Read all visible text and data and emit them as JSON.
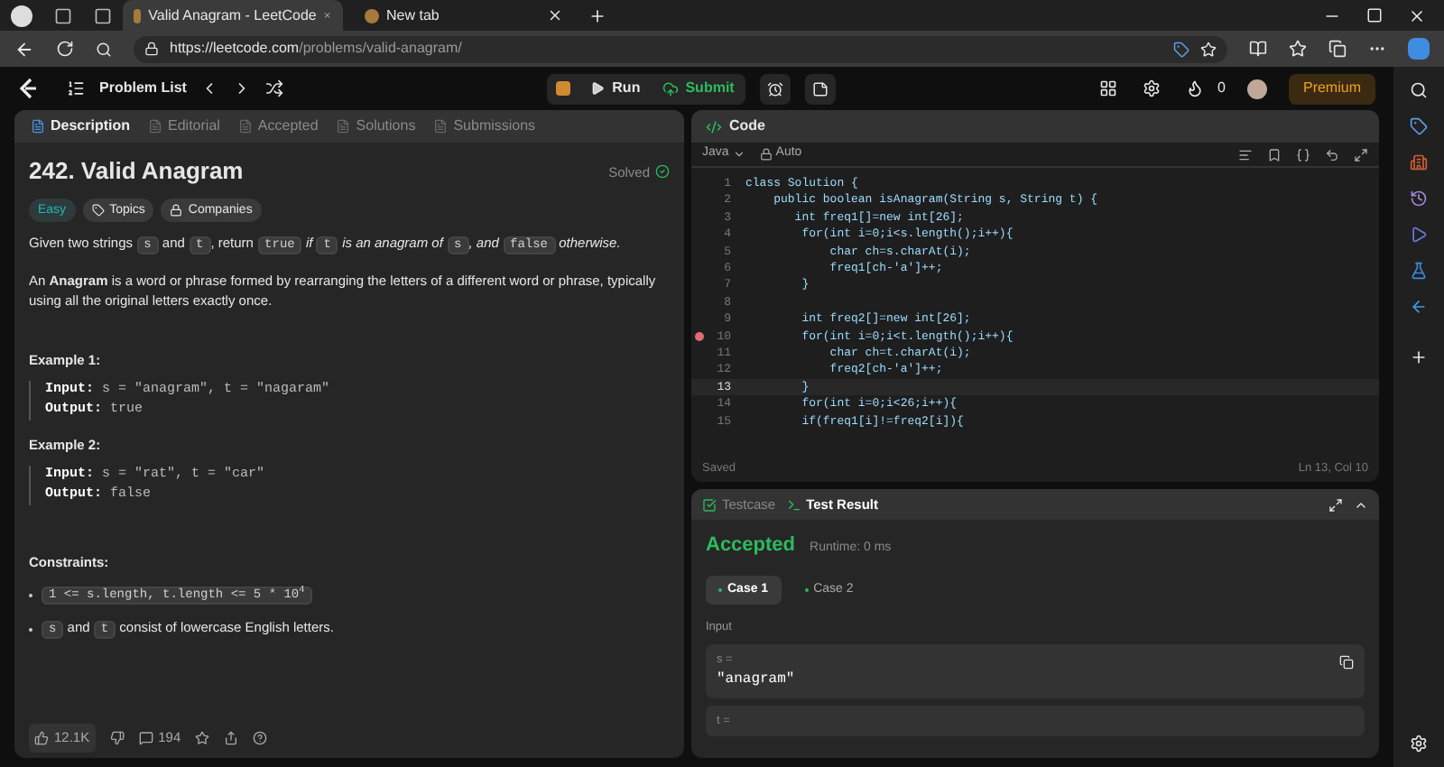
{
  "browser": {
    "tabs": [
      {
        "title": "Valid Anagram - LeetCode",
        "selected": true
      },
      {
        "title": "New tab",
        "selected": false
      }
    ],
    "url_host": "https://leetcode.com",
    "url_path": "/problems/valid-anagram/"
  },
  "header": {
    "problem_list": "Problem List",
    "run": "Run",
    "submit": "Submit",
    "streak": "0",
    "premium": "Premium"
  },
  "left_tabs": [
    {
      "label": "Description",
      "selected": true
    },
    {
      "label": "Editorial",
      "selected": false
    },
    {
      "label": "Accepted",
      "selected": false
    },
    {
      "label": "Solutions",
      "selected": false
    },
    {
      "label": "Submissions",
      "selected": false
    }
  ],
  "problem": {
    "title": "242. Valid Anagram",
    "status": "Solved",
    "difficulty": "Easy",
    "tags": [
      "Topics",
      "Companies"
    ],
    "statement": [
      {
        "kind": "text",
        "text": "Given two strings "
      },
      {
        "kind": "code",
        "text": "s"
      },
      {
        "kind": "text",
        "text": " and "
      },
      {
        "kind": "code",
        "text": "t"
      },
      {
        "kind": "text",
        "text": ", return "
      },
      {
        "kind": "code",
        "text": "true"
      },
      {
        "kind": "italic",
        "text": " if "
      },
      {
        "kind": "code",
        "text": "t"
      },
      {
        "kind": "italic",
        "text": " is an anagram of "
      },
      {
        "kind": "code",
        "text": "s"
      },
      {
        "kind": "italic",
        "text": ", and "
      },
      {
        "kind": "code",
        "text": "false"
      },
      {
        "kind": "italic",
        "text": " otherwise."
      }
    ],
    "definition": "An **Anagram** is a word or phrase formed by rearranging the letters of a different word or phrase, typically using all the original letters exactly once.",
    "examples": [
      {
        "title": "Example 1:",
        "input_label": "Input:",
        "input": "s = \"anagram\", t = \"nagaram\"",
        "output_label": "Output:",
        "output": "true"
      },
      {
        "title": "Example 2:",
        "input_label": "Input:",
        "input": "s = \"rat\", t = \"car\"",
        "output_label": "Output:",
        "output": "false"
      }
    ],
    "constraints_title": "Constraints:",
    "constraints": [
      [
        {
          "kind": "code",
          "text": "1 <= s.length, t.length <= 5 * 10$^{4}$"
        }
      ],
      [
        {
          "kind": "code",
          "text": "s"
        },
        {
          "kind": "text",
          "text": " and "
        },
        {
          "kind": "code",
          "text": "t"
        },
        {
          "kind": "text",
          "text": " consist of lowercase English letters."
        }
      ]
    ],
    "likes": "12.1K",
    "comments": "194"
  },
  "editor": {
    "title": "Code",
    "language": "Java",
    "mode": "Auto",
    "status": "Saved",
    "cursor": "Ln 13, Col 10",
    "lines": [
      {
        "n": "1",
        "text": "class Solution {",
        "breakpoint": false,
        "current": false
      },
      {
        "n": "2",
        "text": "    public boolean isAnagram(String s, String t) {",
        "breakpoint": false,
        "current": false
      },
      {
        "n": "3",
        "text": "       int freq1[]=new int[26];",
        "breakpoint": false,
        "current": false
      },
      {
        "n": "4",
        "text": "        for(int i=0;i<s.length();i++){",
        "breakpoint": false,
        "current": false
      },
      {
        "n": "5",
        "text": "            char ch=s.charAt(i);",
        "breakpoint": false,
        "current": false
      },
      {
        "n": "6",
        "text": "            freq1[ch-'a']++;",
        "breakpoint": false,
        "current": false
      },
      {
        "n": "7",
        "text": "        }",
        "breakpoint": false,
        "current": false
      },
      {
        "n": "8",
        "breakpoint": false,
        "current": false
      },
      {
        "n": "9",
        "text": "        int freq2[]=new int[26];",
        "breakpoint": false,
        "current": false
      },
      {
        "n": "10",
        "text": "        for(int i=0;i<t.length();i++){",
        "breakpoint": true,
        "current": false
      },
      {
        "n": "11",
        "text": "            char ch=t.charAt(i);",
        "breakpoint": false,
        "current": false
      },
      {
        "n": "12",
        "text": "            freq2[ch-'a']++;",
        "breakpoint": false,
        "current": false
      },
      {
        "n": "13",
        "text": "        }",
        "breakpoint": false,
        "current": true
      },
      {
        "n": "14",
        "text": "        for(int i=0;i<26;i++){",
        "breakpoint": false,
        "current": false
      },
      {
        "n": "15",
        "text": "        if(freq1[i]!=freq2[i]){",
        "breakpoint": false,
        "current": false
      }
    ]
  },
  "result": {
    "tabs": [
      {
        "label": "Testcase",
        "selected": false
      },
      {
        "label": "Test Result",
        "selected": true
      }
    ],
    "verdict": "Accepted",
    "runtime": "Runtime: 0 ms",
    "cases": [
      {
        "label": "Case 1",
        "selected": true
      },
      {
        "label": "Case 2",
        "selected": false
      }
    ],
    "input_label": "Input",
    "inputs": [
      {
        "name": "s =",
        "value": "\"anagram\""
      },
      {
        "name": "t ="
      }
    ]
  }
}
